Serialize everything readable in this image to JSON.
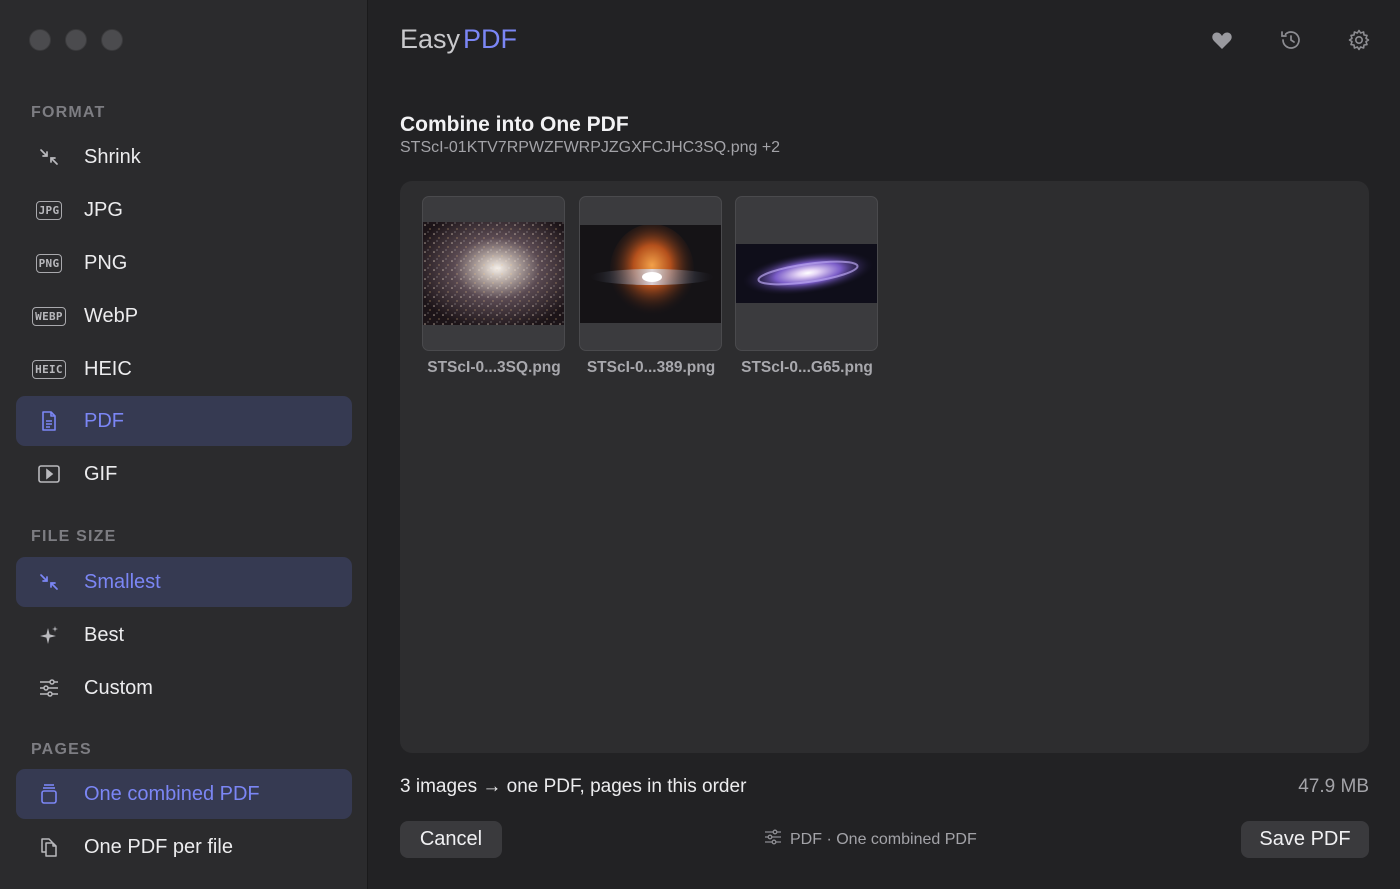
{
  "window": {
    "controls": [
      "close",
      "minimize",
      "zoom"
    ]
  },
  "app": {
    "name_part1": "Easy",
    "name_part2": "PDF"
  },
  "toolbar": {
    "icons": [
      "heart-icon",
      "history-icon",
      "gear-icon"
    ]
  },
  "sidebar": {
    "format_label": "FORMAT",
    "format_items": [
      {
        "label": "Shrink",
        "icon": "shrink-icon"
      },
      {
        "label": "JPG",
        "icon": "JPG"
      },
      {
        "label": "PNG",
        "icon": "PNG"
      },
      {
        "label": "WebP",
        "icon": "WEBP"
      },
      {
        "label": "HEIC",
        "icon": "HEIC"
      },
      {
        "label": "PDF",
        "icon": "document-icon",
        "active": true
      },
      {
        "label": "GIF",
        "icon": "play-icon"
      }
    ],
    "filesize_label": "FILE SIZE",
    "filesize_items": [
      {
        "label": "Smallest",
        "icon": "shrink-icon",
        "active": true
      },
      {
        "label": "Best",
        "icon": "sparkle-icon"
      },
      {
        "label": "Custom",
        "icon": "sliders-icon"
      }
    ],
    "pages_label": "PAGES",
    "pages_items": [
      {
        "label": "One combined PDF",
        "icon": "stack-icon",
        "active": true
      },
      {
        "label": "One PDF per file",
        "icon": "copy-docs-icon"
      }
    ]
  },
  "main": {
    "title": "Combine into One PDF",
    "subtitle": "STScI-01KTV7RPWZFWRPJZGXFCJHC3SQ.png +2",
    "thumbnails": [
      {
        "label": "STScI-0...3SQ.png"
      },
      {
        "label": "STScI-0...389.png"
      },
      {
        "label": "STScI-0...G65.png"
      }
    ],
    "summary": "3 images → one PDF, pages in this order",
    "size": "47.9 MB",
    "cancel_label": "Cancel",
    "status_text": "PDF · One combined PDF",
    "save_label": "Save PDF"
  },
  "colors": {
    "accent": "#7b86f5",
    "active_bg": "#363a52",
    "sidebar_bg": "#2b2b2d",
    "main_bg": "#222224"
  }
}
